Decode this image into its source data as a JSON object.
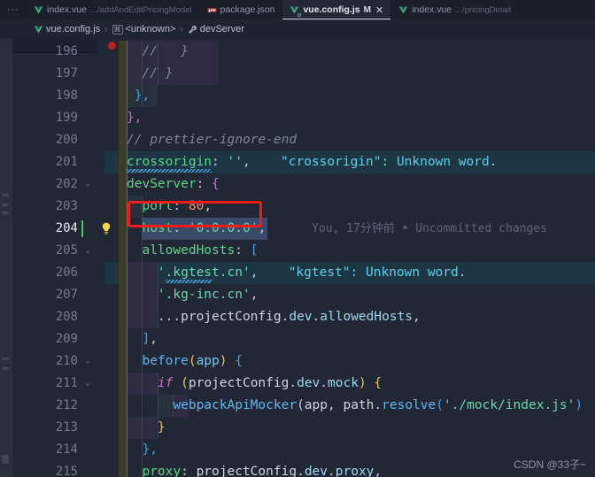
{
  "window": {
    "theme_bg": "#212734",
    "tabbar_bg": "#1b1f2a",
    "accent": "#3ec95c",
    "annotation_color": "#f01c1c"
  },
  "tabbar": {
    "overflow_label": "···",
    "tabs": [
      {
        "icon": "vue-file-icon",
        "name": "index.vue",
        "path": ".../addAndEditPricingModel",
        "modified": "",
        "active": false,
        "closable": false
      },
      {
        "icon": "json-file-icon",
        "name": "package.json",
        "path": "",
        "modified": "",
        "active": false,
        "closable": false
      },
      {
        "icon": "vue-config-file-icon",
        "name": "vue.config.js",
        "path": "",
        "modified": "M",
        "active": true,
        "closable": true,
        "close_label": "✕"
      },
      {
        "icon": "vue-file-icon",
        "name": "index.vue",
        "path": ".../pricingDetail",
        "modified": "",
        "active": false,
        "closable": false
      }
    ]
  },
  "breadcrumb": {
    "separator": "›",
    "segments": [
      {
        "icon": "vue-config-file-icon",
        "label": "vue.config.js",
        "badge": ""
      },
      {
        "icon": "module-badge-icon",
        "label": "<unknown>",
        "badge": "⌘"
      },
      {
        "icon": "wrench-icon",
        "label": "devServer",
        "badge": ""
      }
    ]
  },
  "editor": {
    "first_line": 196,
    "cursor_line": 204,
    "gutter": {
      "breakpoint_marker": "breakpoint-dot",
      "lightbulb_line": 204,
      "lightbulb_title": "quick-fix-lightbulb",
      "fold_chevron": "⌄",
      "fold_lines": [
        202,
        205,
        210,
        211
      ]
    },
    "blame": {
      "line": 204,
      "text": "You, 17分钟前 • Uncommitted changes"
    },
    "diagnostics": [
      {
        "line": 201,
        "text": "\"crossorigin\": Unknown word."
      },
      {
        "line": 206,
        "text": "\"kgtest\": Unknown word."
      }
    ],
    "lines": [
      {
        "n": 196,
        "tokens": [
          {
            "t": "  //   }",
            "c": "t-cmt"
          }
        ]
      },
      {
        "n": 197,
        "tokens": [
          {
            "t": "  // }",
            "c": "t-cmt"
          }
        ]
      },
      {
        "n": 198,
        "tokens": [
          {
            "t": " },",
            "c": "t-brc-b"
          }
        ]
      },
      {
        "n": 199,
        "tokens": [
          {
            "t": "},",
            "c": "t-brc-p"
          }
        ]
      },
      {
        "n": 200,
        "tokens": [
          {
            "t": "// prettier-ignore-end",
            "c": "t-cmt"
          }
        ]
      },
      {
        "n": 201,
        "tokens": [
          {
            "t": "crossorigin",
            "c": "t-prop"
          },
          {
            "t": ": ",
            "c": "t-punct"
          },
          {
            "t": "''",
            "c": "t-str"
          },
          {
            "t": ",",
            "c": "t-punct"
          }
        ]
      },
      {
        "n": 202,
        "tokens": [
          {
            "t": "devServer",
            "c": "t-prop"
          },
          {
            "t": ": ",
            "c": "t-punct"
          },
          {
            "t": "{",
            "c": "t-brc-p"
          }
        ]
      },
      {
        "n": 203,
        "tokens": [
          {
            "t": "  port",
            "c": "t-prop"
          },
          {
            "t": ": ",
            "c": "t-punct"
          },
          {
            "t": "80",
            "c": "t-num"
          },
          {
            "t": ",",
            "c": "t-punct"
          }
        ]
      },
      {
        "n": 204,
        "tokens": [
          {
            "t": "  host",
            "c": "t-prop"
          },
          {
            "t": ": ",
            "c": "t-punct"
          },
          {
            "t": "'0.0.0.0'",
            "c": "t-str"
          },
          {
            "t": ",",
            "c": "t-punct"
          }
        ]
      },
      {
        "n": 205,
        "tokens": [
          {
            "t": "  allowedHosts",
            "c": "t-prop"
          },
          {
            "t": ": ",
            "c": "t-punct"
          },
          {
            "t": "[",
            "c": "t-brc-b"
          }
        ]
      },
      {
        "n": 206,
        "tokens": [
          {
            "t": "    '.kgtest.cn'",
            "c": "t-str"
          },
          {
            "t": ",",
            "c": "t-punct"
          }
        ]
      },
      {
        "n": 207,
        "tokens": [
          {
            "t": "    '.kg-inc.cn'",
            "c": "t-str"
          },
          {
            "t": ",",
            "c": "t-punct"
          }
        ]
      },
      {
        "n": 208,
        "tokens": [
          {
            "t": "    ...",
            "c": "t-punct"
          },
          {
            "t": "projectConfig",
            "c": "t-var"
          },
          {
            "t": ".",
            "c": "t-punct"
          },
          {
            "t": "dev",
            "c": "t-obj"
          },
          {
            "t": ".",
            "c": "t-punct"
          },
          {
            "t": "allowedHosts",
            "c": "t-obj"
          },
          {
            "t": ",",
            "c": "t-punct"
          }
        ]
      },
      {
        "n": 209,
        "tokens": [
          {
            "t": "  ]",
            "c": "t-brc-b"
          },
          {
            "t": ",",
            "c": "t-punct"
          }
        ]
      },
      {
        "n": 210,
        "tokens": [
          {
            "t": "  before",
            "c": "t-fn"
          },
          {
            "t": "(",
            "c": "t-brc-y"
          },
          {
            "t": "app",
            "c": "t-param"
          },
          {
            "t": ")",
            "c": "t-brc-y"
          },
          {
            "t": " ",
            "c": "t-punct"
          },
          {
            "t": "{",
            "c": "t-brc-b"
          }
        ]
      },
      {
        "n": 211,
        "tokens": [
          {
            "t": "    if",
            "c": "t-kw"
          },
          {
            "t": " ",
            "c": "t-punct"
          },
          {
            "t": "(",
            "c": "t-brc-y"
          },
          {
            "t": "projectConfig",
            "c": "t-var"
          },
          {
            "t": ".",
            "c": "t-punct"
          },
          {
            "t": "dev",
            "c": "t-obj"
          },
          {
            "t": ".",
            "c": "t-punct"
          },
          {
            "t": "mock",
            "c": "t-obj"
          },
          {
            "t": ")",
            "c": "t-brc-y"
          },
          {
            "t": " ",
            "c": "t-punct"
          },
          {
            "t": "{",
            "c": "t-brc-y"
          }
        ]
      },
      {
        "n": 212,
        "tokens": [
          {
            "t": "      webpackApiMocker",
            "c": "t-fn"
          },
          {
            "t": "(",
            "c": "t-punct"
          },
          {
            "t": "app",
            "c": "t-var"
          },
          {
            "t": ", ",
            "c": "t-punct"
          },
          {
            "t": "path",
            "c": "t-var"
          },
          {
            "t": ".",
            "c": "t-punct"
          },
          {
            "t": "resolve",
            "c": "t-fn"
          },
          {
            "t": "(",
            "c": "t-brc-b"
          },
          {
            "t": "'./mock/index.js'",
            "c": "t-str"
          },
          {
            "t": ")",
            "c": "t-brc-b"
          }
        ]
      },
      {
        "n": 213,
        "tokens": [
          {
            "t": "    }",
            "c": "t-brc-y"
          }
        ]
      },
      {
        "n": 214,
        "tokens": [
          {
            "t": "  },",
            "c": "t-brc-b"
          }
        ]
      },
      {
        "n": 215,
        "tokens": [
          {
            "t": "  proxy",
            "c": "t-prop"
          },
          {
            "t": ": ",
            "c": "t-punct"
          },
          {
            "t": "projectConfig",
            "c": "t-var"
          },
          {
            "t": ".",
            "c": "t-punct"
          },
          {
            "t": "dev",
            "c": "t-obj"
          },
          {
            "t": ".",
            "c": "t-punct"
          },
          {
            "t": "proxy",
            "c": "t-obj"
          },
          {
            "t": ",",
            "c": "t-punct"
          }
        ]
      }
    ]
  },
  "watermark": {
    "text": "CSDN @33子~"
  }
}
